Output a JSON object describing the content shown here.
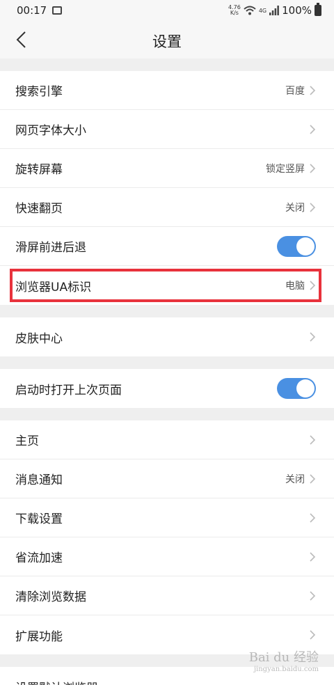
{
  "status": {
    "time": "00:17",
    "speed_top": "4.76",
    "speed_unit": "K/s",
    "net": "4G",
    "battery": "100%"
  },
  "header": {
    "title": "设置"
  },
  "group1": [
    {
      "label": "搜索引擎",
      "value": "百度"
    },
    {
      "label": "网页字体大小",
      "value": ""
    },
    {
      "label": "旋转屏幕",
      "value": "锁定竖屏"
    },
    {
      "label": "快速翻页",
      "value": "关闭"
    },
    {
      "label": "滑屏前进后退",
      "toggle": true
    },
    {
      "label": "浏览器UA标识",
      "value": "电脑"
    }
  ],
  "group2": [
    {
      "label": "皮肤中心"
    }
  ],
  "group3": [
    {
      "label": "启动时打开上次页面",
      "toggle": true
    }
  ],
  "group4": [
    {
      "label": "主页"
    },
    {
      "label": "消息通知",
      "value": "关闭"
    },
    {
      "label": "下载设置"
    },
    {
      "label": "省流加速"
    },
    {
      "label": "清除浏览数据"
    },
    {
      "label": "扩展功能"
    }
  ],
  "group5": [
    {
      "label": "设置默认浏览器"
    }
  ],
  "watermark": {
    "text": "Bai du 经验",
    "sub": "jingyan.baidu.com"
  },
  "colors": {
    "toggle_on": "#4a90e2",
    "highlight": "#e8323c"
  }
}
